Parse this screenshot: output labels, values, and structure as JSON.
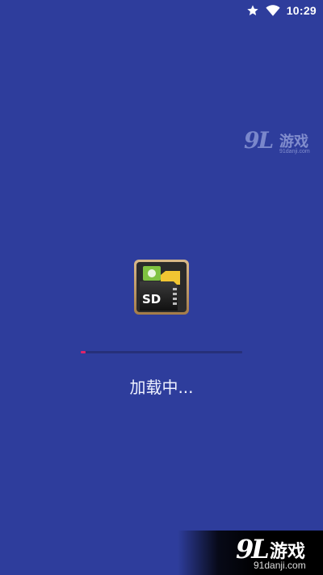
{
  "status_bar": {
    "time": "10:29",
    "icons": [
      "star-icon",
      "wifi-icon"
    ]
  },
  "app": {
    "icon": "sd-card-folder-icon",
    "icon_text": "SD"
  },
  "progress": {
    "fraction": 0.03,
    "fill_color": "#e0246a"
  },
  "loading_text": "加载中...",
  "watermark": {
    "logo": "9L",
    "name": "游戏",
    "site": "91danji.com"
  },
  "colors": {
    "background": "#2e3d9c",
    "progress_track": "#26307a",
    "progress_fill": "#e0246a"
  }
}
